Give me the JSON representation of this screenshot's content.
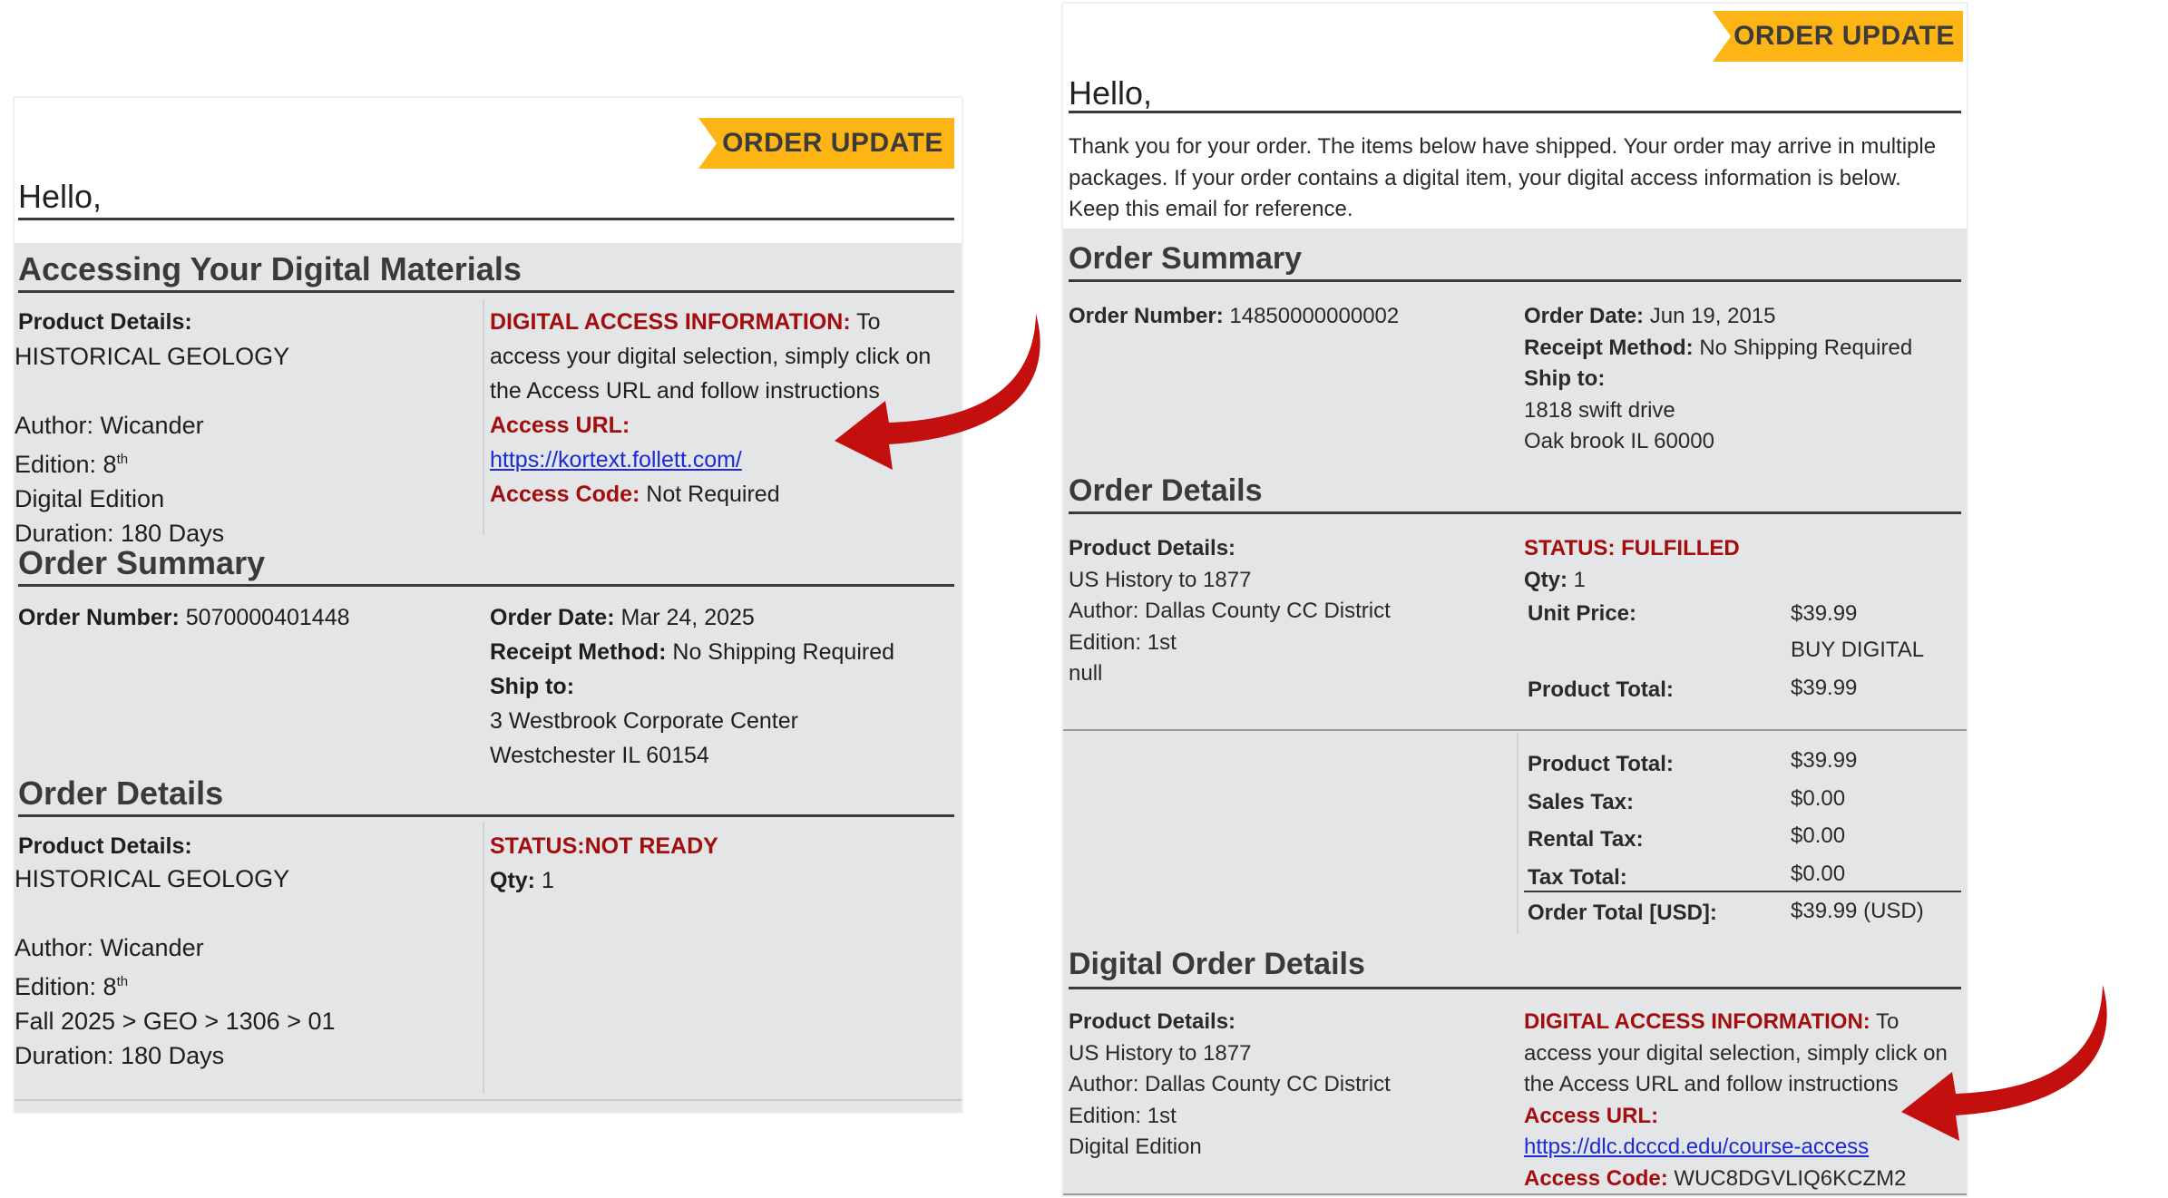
{
  "left": {
    "banner": "ORDER UPDATE",
    "greeting": "Hello,",
    "digital_section": {
      "title": "Accessing Your Digital Materials",
      "product_details_label": "Product Details:",
      "product_name": "HISTORICAL GEOLOGY",
      "author": "Author: Wicander",
      "edition_prefix": "Edition: 8",
      "edition_sup": "th",
      "format": "Digital Edition",
      "duration": "Duration: 180 Days",
      "access_info_label": "DIGITAL ACCESS INFORMATION:",
      "access_info_line1": " To",
      "access_info_line2": "access your digital selection, simply click on",
      "access_info_line3": "the Access URL and follow instructions",
      "access_url_label": "Access URL:",
      "access_url": "https://kortext.follett.com/",
      "access_code_label": "Access Code:",
      "access_code": " Not Required"
    },
    "order_summary": {
      "title": "Order Summary",
      "order_number_label": "Order Number:",
      "order_number": " 5070000401448",
      "order_date_label": "Order Date:",
      "order_date": " Mar 24, 2025",
      "receipt_method_label": "Receipt Method:",
      "receipt_method": " No Shipping Required",
      "ship_to_label": "Ship to:",
      "ship_to_line1": "3 Westbrook Corporate Center",
      "ship_to_line2": "Westchester IL 60154"
    },
    "order_details": {
      "title": "Order Details",
      "product_details_label": "Product Details:",
      "product_name": "HISTORICAL GEOLOGY",
      "author": "Author: Wicander",
      "edition_prefix": "Edition: 8",
      "edition_sup": "th",
      "section": "Fall 2025 > GEO > 1306 > 01",
      "duration": "Duration: 180 Days",
      "status": "STATUS:NOT READY",
      "qty_label": "Qty:",
      "qty": " 1"
    }
  },
  "right": {
    "banner": "ORDER UPDATE",
    "greeting": "Hello,",
    "intro_line1": "Thank you for your order. The items below have shipped. Your order may arrive in multiple",
    "intro_line2": "packages. If your order contains a digital item, your digital access information is below.",
    "intro_line3": "Keep this email for reference.",
    "order_summary": {
      "title": "Order Summary",
      "order_number_label": "Order Number:",
      "order_number": " 14850000000002",
      "order_date_label": "Order Date:",
      "order_date": " Jun 19, 2015",
      "receipt_method_label": "Receipt Method:",
      "receipt_method": " No Shipping Required",
      "ship_to_label": "Ship to:",
      "ship_to_line1": "1818 swift drive",
      "ship_to_line2": "Oak brook IL 60000"
    },
    "order_details": {
      "title": "Order Details",
      "product_details_label": "Product Details:",
      "product_name": "US History to 1877",
      "author": "Author: Dallas County CC District",
      "edition": "Edition: 1st",
      "extra": "null",
      "status": "STATUS: FULFILLED",
      "qty_label": "Qty:",
      "qty": " 1",
      "unit_price_label": "Unit Price:",
      "unit_price": "$39.99",
      "unit_type": "BUY DIGITAL",
      "product_total_label": "Product Total:",
      "product_total": "$39.99"
    },
    "totals": {
      "product_total_label": "Product Total:",
      "product_total": "$39.99",
      "sales_tax_label": "Sales Tax:",
      "sales_tax": "$0.00",
      "rental_tax_label": "Rental Tax:",
      "rental_tax": "$0.00",
      "tax_total_label": "Tax Total:",
      "tax_total": "$0.00",
      "order_total_label": "Order Total [USD]:",
      "order_total": "$39.99 (USD)"
    },
    "digital_order": {
      "title": "Digital Order Details",
      "product_details_label": "Product Details:",
      "product_name": "US History to 1877",
      "author": "Author: Dallas County CC District",
      "edition": "Edition: 1st",
      "format": "Digital Edition",
      "access_info_label": "DIGITAL ACCESS INFORMATION:",
      "access_info_line1": " To",
      "access_info_line2": "access your digital selection, simply click on",
      "access_info_line3": "the Access URL and follow instructions",
      "access_url_label": "Access URL:",
      "access_url": "https://dlc.dcccd.edu/course-access",
      "access_code_label": "Access Code:",
      "access_code": " WUC8DGVLIQ6KCZM2"
    }
  },
  "colors": {
    "banner": "#fdb515",
    "panel": "#e4e5e7",
    "status_red": "#a30d0d",
    "link_blue": "#1a2bd6",
    "arrow_red": "#c40f0f"
  }
}
